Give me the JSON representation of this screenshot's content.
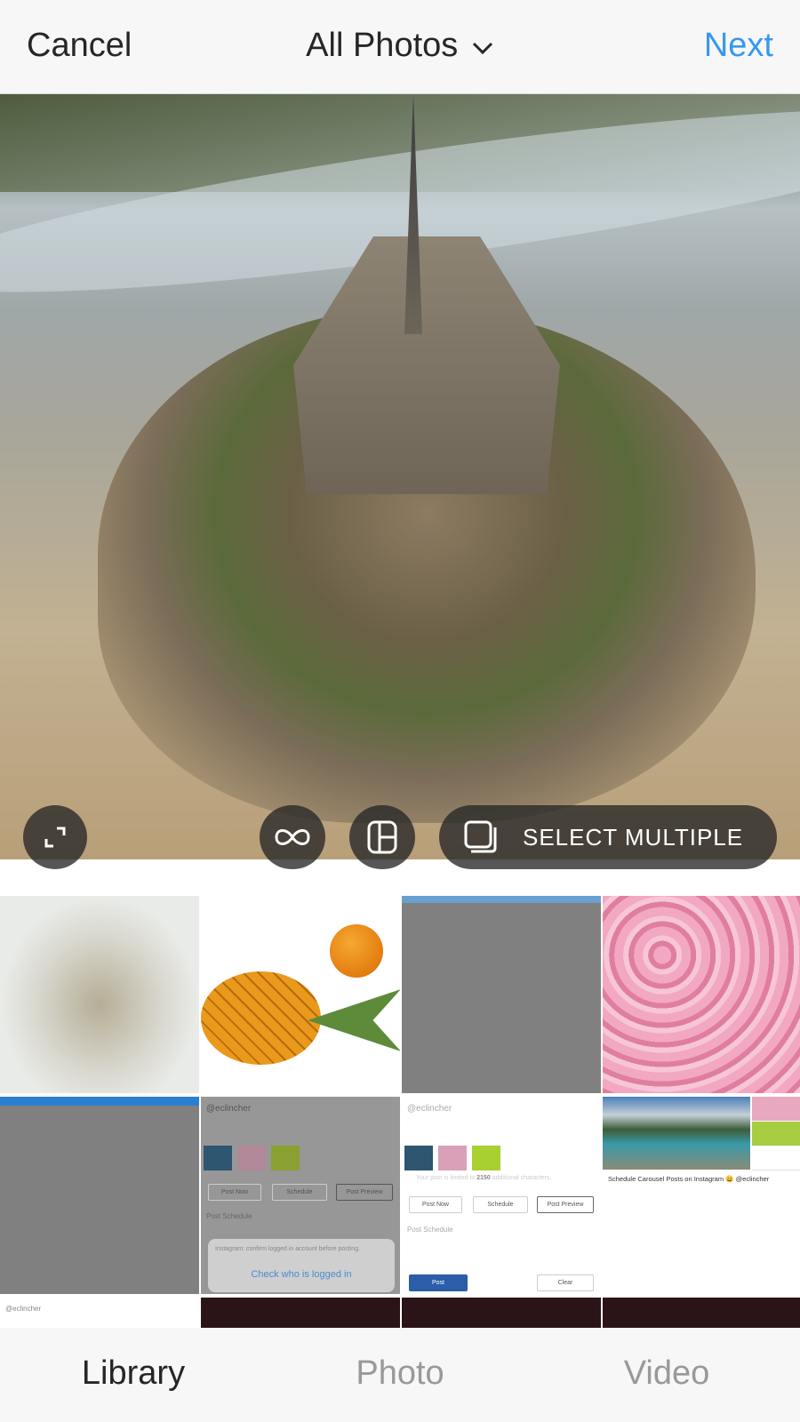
{
  "header": {
    "cancel_label": "Cancel",
    "title": "All Photos",
    "title_icon": "chevron-down-icon",
    "next_label": "Next",
    "next_color": "#3897f0"
  },
  "preview": {
    "buttons": {
      "expand_icon": "expand-icon",
      "boomerang_icon": "infinity-icon",
      "layout_icon": "layout-icon",
      "select_multiple_icon": "stacked-squares-icon",
      "select_multiple_label": "SELECT MULTIPLE"
    }
  },
  "grid": {
    "screenshot_a": {
      "handle": "@eclincher",
      "post_now": "Post Now",
      "schedule": "Schedule",
      "post_preview": "Post Preview",
      "post_schedule": "Post Schedule",
      "alert_text": "Instagram: confirm logged in account before posting.",
      "alert_action": "Check who is logged in"
    },
    "screenshot_b": {
      "handle": "@eclincher",
      "limit_text_pre": "Your post is limited to ",
      "limit_count": "2150",
      "limit_text_post": " additional characters.",
      "post_now": "Post Now",
      "schedule": "Schedule",
      "post_preview": "Post Preview",
      "post_schedule": "Post Schedule",
      "post": "Post",
      "clear": "Clear"
    },
    "carousel_caption": "Schedule Carousel Posts on Instagram 😀 @eclincher",
    "row3_handle": "@eclincher"
  },
  "tabs": [
    {
      "label": "Library",
      "active": true
    },
    {
      "label": "Photo",
      "active": false
    },
    {
      "label": "Video",
      "active": false
    }
  ]
}
